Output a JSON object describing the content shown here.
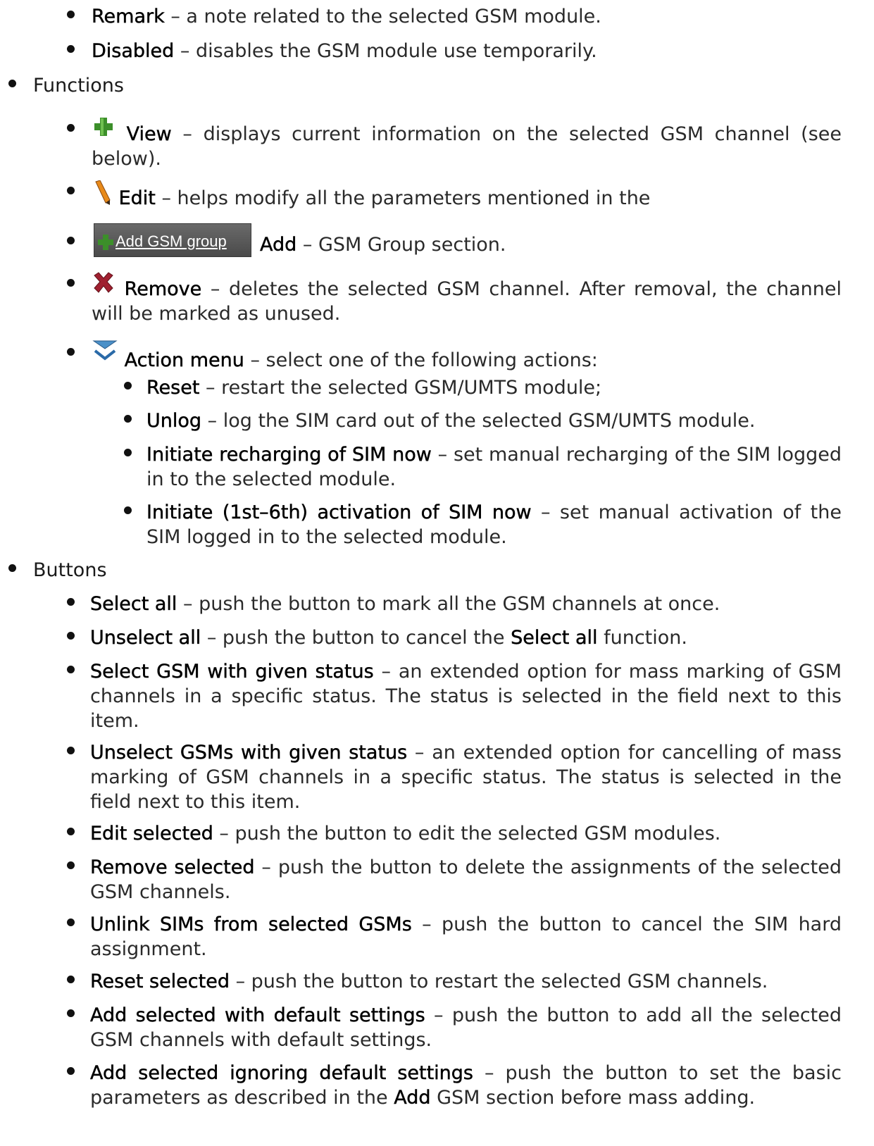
{
  "remark": {
    "term": "Remark",
    "desc": " – a note related to the selected GSM module."
  },
  "disabled": {
    "term": "Disabled",
    "desc": " – disables the GSM module use temporarily."
  },
  "functions": {
    "heading": "Functions",
    "view": {
      "icon": "plus-icon",
      "term": "View",
      "desc": " – displays current information on the selected GSM channel (see below)."
    },
    "edit": {
      "icon": "pencil-icon",
      "term": "Edit",
      "desc": " – helps modify all the parameters mentioned in the"
    },
    "add": {
      "button_label": "Add GSM group",
      "term": "Add",
      "desc": " – GSM Group section."
    },
    "remove": {
      "icon": "red-x-icon",
      "term": "Remove",
      "desc": " – deletes the selected GSM channel. After removal, the channel will be marked as unused."
    },
    "action_menu": {
      "icon": "double-chevron-down-icon",
      "term": "Action menu",
      "desc": " – select one of the following actions:",
      "items": [
        {
          "term": "Reset",
          "desc": " – restart the selected GSM/UMTS module;"
        },
        {
          "term": "Unlog",
          "desc": " – log the SIM card out of the selected GSM/UMTS module."
        },
        {
          "term": "Initiate recharging of SIM now",
          "desc": " – set manual recharging of the SIM logged in to the selected module."
        },
        {
          "term": "Initiate (1st–6th) activation of SIM now",
          "desc": " – set manual activation of the SIM logged in to the selected module."
        }
      ]
    }
  },
  "buttons": {
    "heading": "Buttons",
    "items": [
      {
        "term": "Select all",
        "desc": " – push the button to mark all the GSM channels at once."
      },
      {
        "term": "Unselect all",
        "desc": " – push the button to cancel the ",
        "term2": "Select all",
        "desc2": " function."
      },
      {
        "term": "Select GSM with given status",
        "desc": " – an extended option for mass marking of GSM channels in a specific status. The status is selected in the field next to this item."
      },
      {
        "term": "Unselect GSMs with given status",
        "desc": " – an extended option for cancelling of mass marking of GSM channels in a specific status. The status is selected in the field next to this item."
      },
      {
        "term": "Edit selected",
        "desc": " – push the button to edit the selected GSM modules."
      },
      {
        "term": "Remove selected",
        "desc": " – push the button to delete the assignments of the selected GSM channels."
      },
      {
        "term": "Unlink SIMs from selected GSMs",
        "desc": " – push the button to cancel the SIM hard assignment."
      },
      {
        "term": "Reset selected",
        "desc": " – push the button to restart the selected GSM channels."
      },
      {
        "term": "Add selected with default settings",
        "desc": " – push the button to add all the selected GSM channels with default settings."
      },
      {
        "term": "Add selected ignoring default settings",
        "desc": " – push the button to set the basic parameters as described in the ",
        "term2": "Add",
        "desc2": " GSM section before mass adding."
      }
    ]
  }
}
